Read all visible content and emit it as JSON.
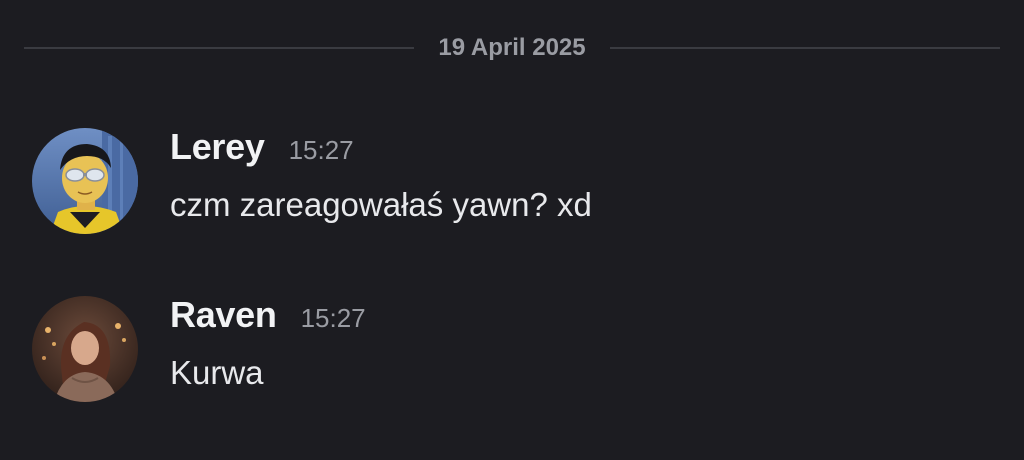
{
  "divider": {
    "date": "19 April 2025"
  },
  "messages": [
    {
      "username": "Lerey",
      "timestamp": "15:27",
      "text": "czm zareagowałaś yawn? xd",
      "avatar": "cartoon-hero-avatar"
    },
    {
      "username": "Raven",
      "timestamp": "15:27",
      "text": "Kurwa",
      "avatar": "photo-avatar"
    }
  ],
  "colors": {
    "background": "#1c1c21",
    "username": "#f2f3f5",
    "muted": "#9a9ca3",
    "divider_line": "#3a3b41"
  }
}
